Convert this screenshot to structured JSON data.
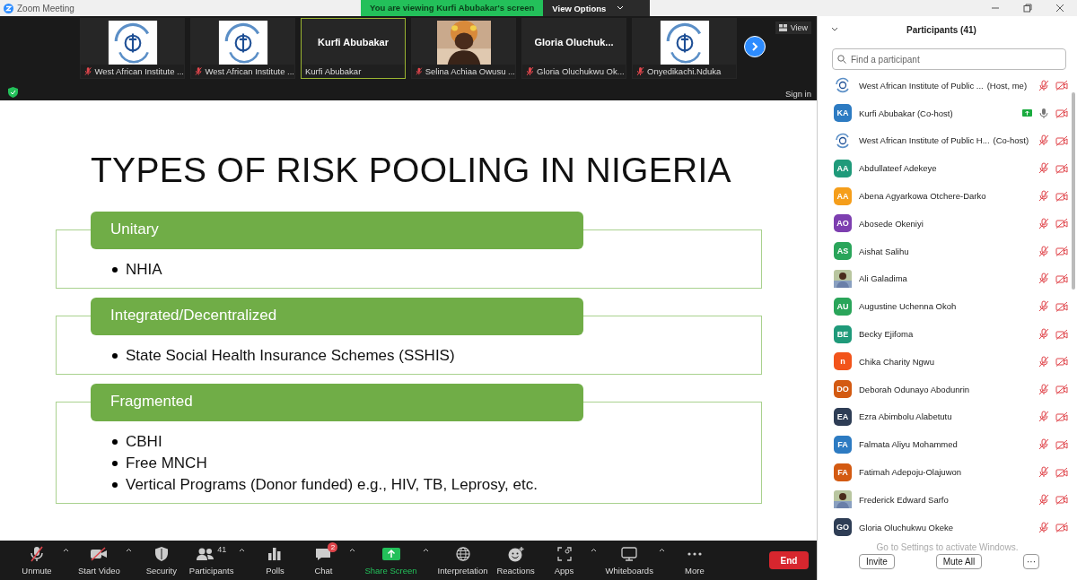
{
  "window": {
    "title": "Zoom Meeting"
  },
  "share_banner": {
    "text": "You are viewing Kurfi Abubakar's screen",
    "options": "View Options"
  },
  "thumbnails": [
    {
      "kind": "logo",
      "label": "West African Institute ...",
      "mic_muted": true,
      "selected": false
    },
    {
      "kind": "logo",
      "label": "West African Institute ...",
      "mic_muted": true,
      "selected": false
    },
    {
      "kind": "name",
      "name": "Kurfi Abubakar",
      "label": "Kurfi Abubakar",
      "mic_muted": false,
      "selected": true
    },
    {
      "kind": "picture",
      "label": "Selina Achiaa Owusu ...",
      "mic_muted": true,
      "selected": false
    },
    {
      "kind": "name",
      "name": "Gloria  Oluchuk...",
      "label": "Gloria Oluchukwu Ok...",
      "mic_muted": true,
      "selected": false
    },
    {
      "kind": "logo",
      "label": "Onyedikachi.Nduka",
      "mic_muted": true,
      "selected": false
    }
  ],
  "view_button": "View",
  "sign_in": "Sign in",
  "slide": {
    "title": "TYPES OF RISK POOLING IN NIGERIA",
    "sections": [
      {
        "heading": "Unitary",
        "bullets": [
          "NHIA"
        ]
      },
      {
        "heading": "Integrated/Decentralized",
        "bullets": [
          "State Social Health Insurance Schemes (SSHIS)"
        ]
      },
      {
        "heading": "Fragmented",
        "bullets": [
          "CBHI",
          "Free MNCH",
          "Vertical Programs (Donor funded)  e.g., HIV, TB, Leprosy, etc."
        ]
      }
    ]
  },
  "toolbar": [
    {
      "label": "Unmute",
      "caret": true,
      "kind": "plain"
    },
    {
      "label": "Start Video",
      "caret": true,
      "kind": "plain"
    },
    {
      "label": "Security",
      "caret": false,
      "kind": "plain"
    },
    {
      "label": "Participants",
      "count": "41",
      "caret": true,
      "kind": "plain"
    },
    {
      "label": "Polls",
      "caret": false,
      "kind": "plain"
    },
    {
      "label": "Chat",
      "badge": "2",
      "caret": true,
      "kind": "plain"
    },
    {
      "label": "Share Screen",
      "caret": true,
      "kind": "share"
    },
    {
      "label": "Interpretation",
      "caret": false,
      "kind": "plain"
    },
    {
      "label": "Reactions",
      "caret": false,
      "kind": "plain"
    },
    {
      "label": "Apps",
      "caret": true,
      "kind": "plain"
    },
    {
      "label": "Whiteboards",
      "caret": true,
      "kind": "plain"
    },
    {
      "label": "More",
      "caret": false,
      "kind": "plain"
    }
  ],
  "end_button": "End",
  "participants_panel": {
    "title": "Participants (41)",
    "search": {
      "placeholder": "Find a participant"
    },
    "participants": [
      {
        "kind": "logo",
        "name": "West African Institute of Public ...",
        "role": "(Host, me)",
        "mic_muted": true,
        "video_off": true,
        "sharing": false
      },
      {
        "kind": "initials",
        "initials": "KA",
        "color": "#2d7bc2",
        "name": "Kurfi Abubakar (Co-host)",
        "mic_muted": false,
        "video_off": true,
        "sharing": true
      },
      {
        "kind": "logo",
        "name": "West African Institute of Public H...",
        "role": "(Co-host)",
        "mic_muted": true,
        "video_off": true,
        "sharing": false
      },
      {
        "kind": "initials",
        "initials": "AA",
        "color": "#1f9a7a",
        "name": "Abdullateef Adekeye",
        "mic_muted": true,
        "video_off": true,
        "sharing": false
      },
      {
        "kind": "initials",
        "initials": "AA",
        "color": "#f59e1b",
        "name": "Abena Agyarkowa Otchere-Darko",
        "mic_muted": true,
        "video_off": true,
        "sharing": false
      },
      {
        "kind": "initials",
        "initials": "AO",
        "color": "#7d3fb0",
        "name": "Abosede Okeniyi",
        "mic_muted": true,
        "video_off": true,
        "sharing": false
      },
      {
        "kind": "initials",
        "initials": "AS",
        "color": "#2aa55a",
        "name": "Aishat Salihu",
        "mic_muted": true,
        "video_off": true,
        "sharing": false
      },
      {
        "kind": "picture",
        "name": "Ali Galadima",
        "mic_muted": true,
        "video_off": true,
        "sharing": false
      },
      {
        "kind": "initials",
        "initials": "AU",
        "color": "#2aa55a",
        "name": "Augustine Uchenna Okoh",
        "mic_muted": true,
        "video_off": true,
        "sharing": false
      },
      {
        "kind": "initials",
        "initials": "BE",
        "color": "#1f9a7a",
        "name": "Becky Ejifoma",
        "mic_muted": true,
        "video_off": true,
        "sharing": false
      },
      {
        "kind": "initials",
        "initials": "n",
        "color": "#f2541b",
        "name": "Chika Charity Ngwu",
        "mic_muted": true,
        "video_off": true,
        "sharing": false
      },
      {
        "kind": "initials",
        "initials": "DO",
        "color": "#d35a12",
        "name": "Deborah Odunayo Abodunrin",
        "mic_muted": true,
        "video_off": true,
        "sharing": false
      },
      {
        "kind": "initials",
        "initials": "EA",
        "color": "#2e3d55",
        "name": "Ezra Abimbolu Alabetutu",
        "mic_muted": true,
        "video_off": true,
        "sharing": false
      },
      {
        "kind": "initials",
        "initials": "FA",
        "color": "#2d7bc2",
        "name": "Falmata Aliyu Mohammed",
        "mic_muted": true,
        "video_off": true,
        "sharing": false
      },
      {
        "kind": "initials",
        "initials": "FA",
        "color": "#d35a12",
        "name": "Fatimah Adepoju-Olajuwon",
        "mic_muted": true,
        "video_off": true,
        "sharing": false
      },
      {
        "kind": "picture",
        "name": "Frederick Edward Sarfo",
        "mic_muted": true,
        "video_off": true,
        "sharing": false
      },
      {
        "kind": "initials",
        "initials": "GO",
        "color": "#2e3d55",
        "name": "Gloria Oluchukwu Okeke",
        "mic_muted": true,
        "video_off": true,
        "sharing": false
      }
    ],
    "notice": "Go to Settings to activate Windows.",
    "buttons": [
      "Invite",
      "Mute All"
    ],
    "more_button": "···"
  }
}
